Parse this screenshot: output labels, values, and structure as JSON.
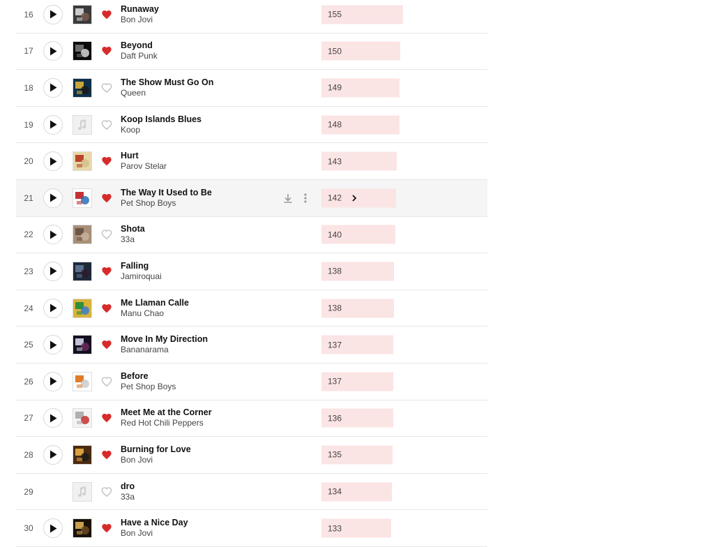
{
  "colors": {
    "heart_active": "#d62b2b",
    "heart_inactive": "#bdbdbd",
    "bar_fill": "#fbe4e4",
    "row_hover": "#f5f5f5"
  },
  "icons": {
    "play": "play-icon",
    "heart": "heart-icon",
    "download": "download-icon",
    "more": "more-options-icon",
    "chevron": "chevron-right-icon"
  },
  "max_count": 155,
  "tracks": [
    {
      "rank": "16",
      "title": "Runaway",
      "artist": "Bon Jovi",
      "count": "155",
      "liked": true,
      "cover": "art",
      "playable": true
    },
    {
      "rank": "17",
      "title": "Beyond",
      "artist": "Daft Punk",
      "count": "150",
      "liked": true,
      "cover": "art",
      "playable": true
    },
    {
      "rank": "18",
      "title": "The Show Must Go On",
      "artist": "Queen",
      "count": "149",
      "liked": false,
      "cover": "art",
      "playable": true
    },
    {
      "rank": "19",
      "title": "Koop Islands Blues",
      "artist": "Koop",
      "count": "148",
      "liked": false,
      "cover": "placeholder",
      "playable": true
    },
    {
      "rank": "20",
      "title": "Hurt",
      "artist": "Parov Stelar",
      "count": "143",
      "liked": true,
      "cover": "art",
      "playable": true
    },
    {
      "rank": "21",
      "title": "The Way It Used to Be",
      "artist": "Pet Shop Boys",
      "count": "142",
      "liked": true,
      "cover": "art",
      "playable": true,
      "hover": true
    },
    {
      "rank": "22",
      "title": "Shota",
      "artist": "33a",
      "count": "140",
      "liked": false,
      "cover": "art",
      "playable": true
    },
    {
      "rank": "23",
      "title": "Falling",
      "artist": "Jamiroquai",
      "count": "138",
      "liked": true,
      "cover": "art",
      "playable": true
    },
    {
      "rank": "24",
      "title": "Me Llaman Calle",
      "artist": "Manu Chao",
      "count": "138",
      "liked": true,
      "cover": "art",
      "playable": true
    },
    {
      "rank": "25",
      "title": "Move In My Direction",
      "artist": "Bananarama",
      "count": "137",
      "liked": true,
      "cover": "art",
      "playable": true
    },
    {
      "rank": "26",
      "title": "Before",
      "artist": "Pet Shop Boys",
      "count": "137",
      "liked": false,
      "cover": "art",
      "playable": true
    },
    {
      "rank": "27",
      "title": "Meet Me at the Corner",
      "artist": "Red Hot Chili Peppers",
      "count": "136",
      "liked": true,
      "cover": "art",
      "playable": true
    },
    {
      "rank": "28",
      "title": "Burning for Love",
      "artist": "Bon Jovi",
      "count": "135",
      "liked": true,
      "cover": "art",
      "playable": true
    },
    {
      "rank": "29",
      "title": "dro",
      "artist": "33a",
      "count": "134",
      "liked": false,
      "cover": "placeholder",
      "playable": false
    },
    {
      "rank": "30",
      "title": "Have a Nice Day",
      "artist": "Bon Jovi",
      "count": "133",
      "liked": true,
      "cover": "art",
      "playable": true
    }
  ]
}
